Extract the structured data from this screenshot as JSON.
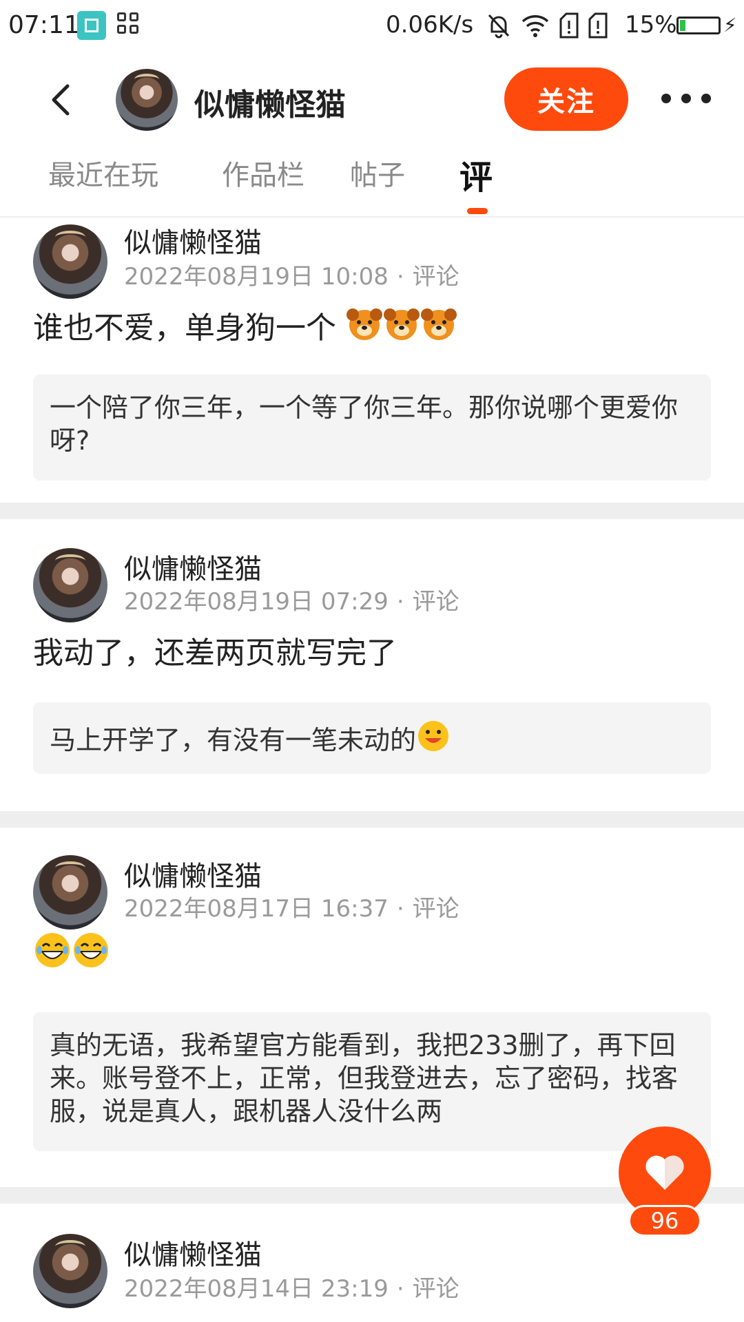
{
  "status_bar": {
    "time": "07:11",
    "speed": "0.06K/s",
    "battery_percent_text": "15%",
    "battery_level": 0.15,
    "icons": [
      "scan-icon",
      "apps-icon",
      "bell-off-icon",
      "wifi-icon",
      "sim1-icon",
      "sim2-icon",
      "battery-icon",
      "charging-icon"
    ]
  },
  "header": {
    "title": "似慵懒怪猫",
    "follow_label": "关注",
    "back_icon": "chevron-left-icon",
    "more_icon": "more-icon"
  },
  "tabs": [
    {
      "label": "最近在玩",
      "active": false
    },
    {
      "label": "作品栏",
      "active": false
    },
    {
      "label": "帖子",
      "active": false
    },
    {
      "label": "评",
      "active": true
    }
  ],
  "colors": {
    "accent": "#ff4a0d",
    "quote_bg": "#f4f4f4",
    "divider": "#eeeeee",
    "meta_text": "#9a9a9a"
  },
  "cards": [
    {
      "name": "似慵懒怪猫",
      "date": "2022年08月19日 10:08",
      "type": "评论",
      "text": "谁也不爱，单身狗一个",
      "emojis": [
        "dog-emoji",
        "dog-emoji",
        "dog-emoji"
      ],
      "quote": "一个陪了你三年，一个等了你三年。那你说哪个更爱你呀?"
    },
    {
      "name": "似慵懒怪猫",
      "date": "2022年08月19日 07:29",
      "type": "评论",
      "text": "我动了，还差两页就写完了",
      "emojis": [],
      "quote": "马上开学了，有没有一笔未动的",
      "quote_emoji": "smile-emoji"
    },
    {
      "name": "似慵懒怪猫",
      "date": "2022年08月17日 16:37",
      "type": "评论",
      "text": "",
      "emojis": [
        "laugh-emoji",
        "laugh-emoji"
      ],
      "quote": "真的无语，我希望官方能看到，我把233删了，再下回来。账号登不上，正常，但我登进去，忘了密码，找客服，说是真人，跟机器人没什么两"
    },
    {
      "name": "似慵懒怪猫",
      "date": "2022年08月14日 23:19",
      "type": "评论"
    }
  ],
  "like": {
    "count": "96",
    "icon": "heart-icon"
  }
}
